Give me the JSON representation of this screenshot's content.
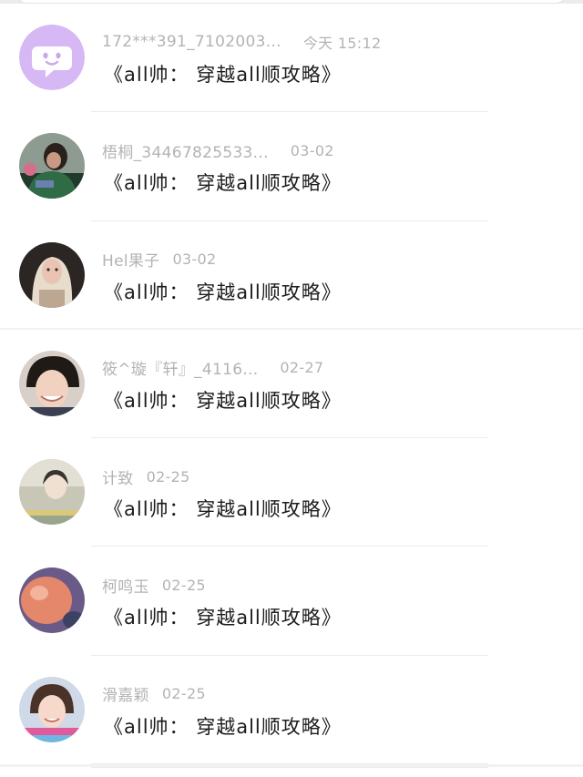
{
  "messages": [
    {
      "sender": "172***391_7102003...",
      "time": "今天 15:12",
      "preview": "《all帅： 穿越all顺攻略》",
      "avatar_icon": "chat-bubble-face-icon",
      "avatar_color": "#d5b8f4"
    },
    {
      "sender": "梧桐_34467825533...",
      "time": "03-02",
      "preview": "《all帅： 穿越all顺攻略》",
      "avatar_icon": "user-photo",
      "avatar_color": "#3d4a3f"
    },
    {
      "sender": "Hel果子",
      "time": "03-02",
      "preview": "《all帅： 穿越all顺攻略》",
      "avatar_icon": "user-photo",
      "avatar_color": "#c9b9a8"
    },
    {
      "sender": "筱^璇『轩』_4116...",
      "time": "02-27",
      "preview": "《all帅： 穿越all顺攻略》",
      "avatar_icon": "user-photo",
      "avatar_color": "#5a4236"
    },
    {
      "sender": "计致",
      "time": "02-25",
      "preview": "《all帅： 穿越all顺攻略》",
      "avatar_icon": "user-photo",
      "avatar_color": "#b9b7a7"
    },
    {
      "sender": "柯鸣玉",
      "time": "02-25",
      "preview": "《all帅： 穿越all顺攻略》",
      "avatar_icon": "user-photo",
      "avatar_color": "#d98a6a"
    },
    {
      "sender": "滑嘉颖",
      "time": "02-25",
      "preview": "《all帅： 穿越all顺攻略》",
      "avatar_icon": "user-photo",
      "avatar_color": "#9fb6d8"
    }
  ]
}
